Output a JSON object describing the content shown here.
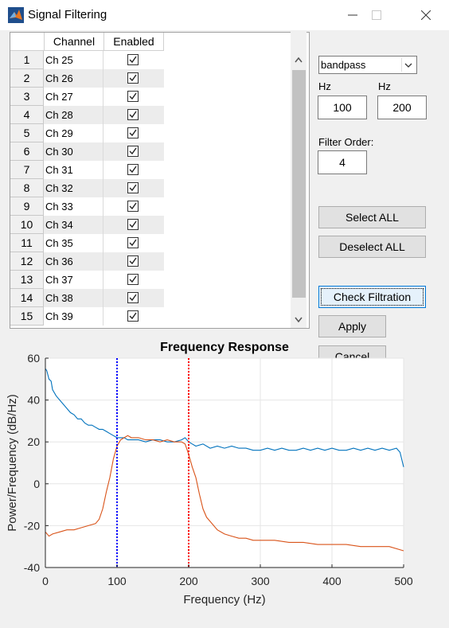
{
  "window": {
    "title": "Signal Filtering"
  },
  "table": {
    "headers": [
      "Channel",
      "Enabled"
    ],
    "rows": [
      {
        "num": "1",
        "channel": "Ch 25",
        "enabled": true
      },
      {
        "num": "2",
        "channel": "Ch 26",
        "enabled": true
      },
      {
        "num": "3",
        "channel": "Ch 27",
        "enabled": true
      },
      {
        "num": "4",
        "channel": "Ch 28",
        "enabled": true
      },
      {
        "num": "5",
        "channel": "Ch 29",
        "enabled": true
      },
      {
        "num": "6",
        "channel": "Ch 30",
        "enabled": true
      },
      {
        "num": "7",
        "channel": "Ch 31",
        "enabled": true
      },
      {
        "num": "8",
        "channel": "Ch 32",
        "enabled": true
      },
      {
        "num": "9",
        "channel": "Ch 33",
        "enabled": true
      },
      {
        "num": "10",
        "channel": "Ch 34",
        "enabled": true
      },
      {
        "num": "11",
        "channel": "Ch 35",
        "enabled": true
      },
      {
        "num": "12",
        "channel": "Ch 36",
        "enabled": true
      },
      {
        "num": "13",
        "channel": "Ch 37",
        "enabled": true
      },
      {
        "num": "14",
        "channel": "Ch 38",
        "enabled": true
      },
      {
        "num": "15",
        "channel": "Ch 39",
        "enabled": true
      }
    ]
  },
  "controls": {
    "filter_type": "bandpass",
    "low_label": "Hz",
    "low_value": "100",
    "high_label": "Hz",
    "high_value": "200",
    "order_label": "Filter Order:",
    "order_value": "4",
    "select_all": "Select ALL",
    "deselect_all": "Deselect ALL",
    "check_filtration": "Check Filtration",
    "apply": "Apply",
    "cancel": "Cancel"
  },
  "chart_data": {
    "type": "line",
    "title": "Frequency Response",
    "xlabel": "Frequency (Hz)",
    "ylabel": "Power/Frequency (dB/Hz)",
    "xlim": [
      0,
      500
    ],
    "ylim": [
      -40,
      60
    ],
    "xticks": [
      0,
      100,
      200,
      300,
      400,
      500
    ],
    "yticks": [
      -40,
      -20,
      0,
      20,
      40,
      60
    ],
    "grid": true,
    "colors": {
      "unfiltered": "#0072bd",
      "filtered": "#d95319",
      "low_cutoff": "#0000ff",
      "high_cutoff": "#ff0000"
    },
    "vlines": [
      100,
      200
    ],
    "series": [
      {
        "x": [
          0,
          2,
          5,
          8,
          10,
          15,
          20,
          25,
          30,
          35,
          40,
          45,
          50,
          55,
          60,
          65,
          70,
          75,
          80,
          85,
          90,
          95,
          100,
          105,
          110,
          115,
          120,
          130,
          140,
          150,
          160,
          170,
          180,
          190,
          195,
          200,
          205,
          210,
          220,
          230,
          240,
          250,
          260,
          270,
          280,
          290,
          300,
          310,
          320,
          330,
          340,
          350,
          360,
          370,
          380,
          390,
          400,
          410,
          420,
          430,
          440,
          450,
          460,
          470,
          480,
          490,
          495,
          500
        ],
        "y": [
          55,
          54,
          50,
          49,
          45,
          42,
          40,
          38,
          36,
          34,
          33,
          31,
          31,
          29,
          28,
          28,
          27,
          26,
          26,
          25,
          24,
          23,
          22,
          22,
          22,
          21,
          21,
          21,
          20,
          21,
          21,
          20,
          20,
          21,
          22,
          20,
          19,
          18,
          19,
          17,
          18,
          17,
          18,
          17,
          17,
          16,
          16,
          17,
          16,
          17,
          16,
          16,
          17,
          16,
          17,
          16,
          17,
          16,
          16,
          17,
          16,
          17,
          16,
          17,
          16,
          17,
          15,
          8
        ]
      },
      {
        "x": [
          0,
          5,
          10,
          20,
          30,
          40,
          50,
          60,
          70,
          75,
          80,
          85,
          90,
          95,
          100,
          105,
          110,
          115,
          120,
          130,
          140,
          150,
          160,
          170,
          180,
          190,
          195,
          200,
          205,
          210,
          215,
          220,
          225,
          230,
          240,
          250,
          260,
          270,
          280,
          290,
          300,
          320,
          340,
          360,
          380,
          400,
          420,
          440,
          460,
          480,
          500
        ],
        "y": [
          -23,
          -25,
          -24,
          -23,
          -22,
          -22,
          -21,
          -20,
          -19,
          -17,
          -12,
          -4,
          3,
          12,
          18,
          21,
          22,
          23,
          22,
          22,
          21,
          21,
          20,
          21,
          20,
          20,
          19,
          14,
          8,
          3,
          -5,
          -12,
          -16,
          -18,
          -22,
          -24,
          -25,
          -26,
          -26,
          -27,
          -27,
          -27,
          -28,
          -28,
          -29,
          -29,
          -29,
          -30,
          -30,
          -30,
          -32
        ]
      }
    ]
  }
}
